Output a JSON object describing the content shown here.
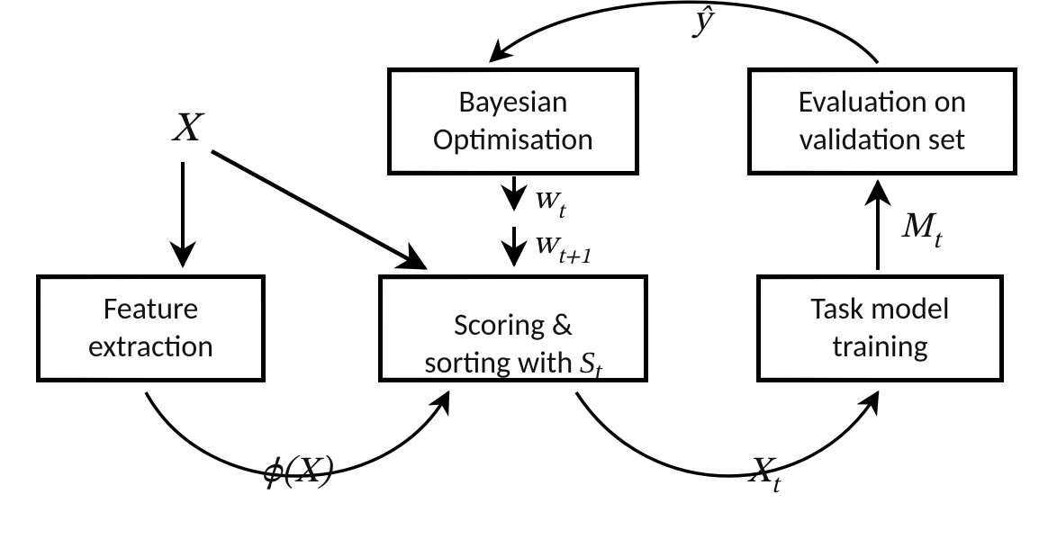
{
  "nodes": {
    "feature_extraction": "Feature\nextraction",
    "bayesian_optimisation": "Bayesian\nOptimisation",
    "scoring_sorting_prefix": "Scoring &\nsorting with ",
    "scoring_sorting_var": "S",
    "scoring_sorting_sub": "t",
    "evaluation": "Evaluation on\nvalidation set",
    "task_training": "Task model\ntraining"
  },
  "labels": {
    "X": "X",
    "phiX": "ϕ(X)",
    "Xt_base": "X",
    "Xt_sub": "t",
    "Mt_base": "M",
    "Mt_sub": "t",
    "yhat": "ŷ",
    "wt_base": "w",
    "wt_sub": "t",
    "wt1_base": "w",
    "wt1_sub": "t+1"
  }
}
